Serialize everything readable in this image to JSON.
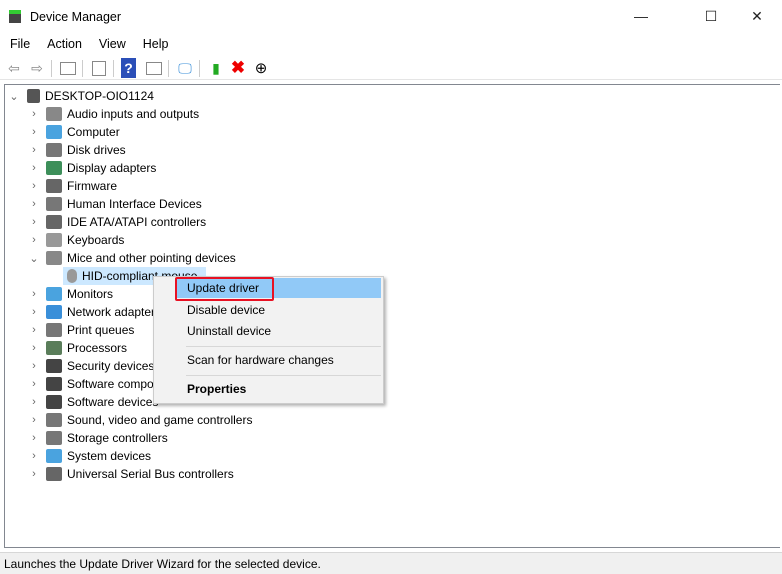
{
  "window": {
    "title": "Device Manager",
    "minimize": "—",
    "maximize": "☐",
    "close": "✕"
  },
  "menu": [
    "File",
    "Action",
    "View",
    "Help"
  ],
  "toolbar": [
    "back-icon",
    "forward-icon",
    "properties-pane-icon",
    "details-icon",
    "help-icon",
    "run-icon",
    "scan-monitor-icon",
    "update-driver-icon",
    "uninstall-icon",
    "disable-icon"
  ],
  "tree": {
    "root": "DESKTOP-OIO1124",
    "items": [
      {
        "label": "Audio inputs and outputs",
        "color": "#888"
      },
      {
        "label": "Computer",
        "color": "#4aa3df"
      },
      {
        "label": "Disk drives",
        "color": "#777"
      },
      {
        "label": "Display adapters",
        "color": "#3d8f5a"
      },
      {
        "label": "Firmware",
        "color": "#666"
      },
      {
        "label": "Human Interface Devices",
        "color": "#777"
      },
      {
        "label": "IDE ATA/ATAPI controllers",
        "color": "#666"
      },
      {
        "label": "Keyboards",
        "color": "#999"
      },
      {
        "label": "Mice and other pointing devices",
        "color": "#888",
        "expanded": true
      },
      {
        "label": "Monitors",
        "color": "#4aa3df"
      },
      {
        "label": "Network adapters",
        "color": "#3a8fd9"
      },
      {
        "label": "Print queues",
        "color": "#777"
      },
      {
        "label": "Processors",
        "color": "#5a7d5a"
      },
      {
        "label": "Security devices",
        "color": "#444"
      },
      {
        "label": "Software components",
        "color": "#444"
      },
      {
        "label": "Software devices",
        "color": "#444"
      },
      {
        "label": "Sound, video and game controllers",
        "color": "#777"
      },
      {
        "label": "Storage controllers",
        "color": "#777"
      },
      {
        "label": "System devices",
        "color": "#4aa3df"
      },
      {
        "label": "Universal Serial Bus controllers",
        "color": "#666"
      }
    ],
    "child": "HID-compliant mouse"
  },
  "context_menu": {
    "items": [
      "Update driver",
      "Disable device",
      "Uninstall device",
      "Scan for hardware changes",
      "Properties"
    ],
    "highlight_color": "#91c9f7",
    "outline_color": "#e81123"
  },
  "status": "Launches the Update Driver Wizard for the selected device."
}
